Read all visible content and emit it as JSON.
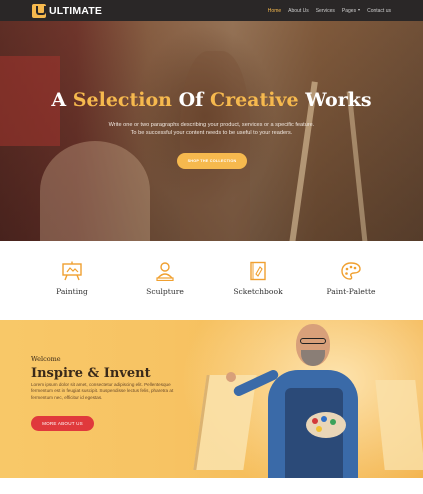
{
  "brand": {
    "name": "ULTIMATE",
    "logo_icon": "u-logo-icon",
    "accent": "#f6b94e"
  },
  "nav": {
    "items": [
      {
        "label": "Home",
        "active": true
      },
      {
        "label": "About Us"
      },
      {
        "label": "Services"
      },
      {
        "label": "Pages"
      },
      {
        "label": "Contact us"
      }
    ]
  },
  "hero": {
    "title_parts": [
      "A",
      "Selection",
      "Of",
      "Creative",
      "Works"
    ],
    "subtitle_line1": "Write one or two paragraphs describing your product, services or a specific feature.",
    "subtitle_line2": "To be successful your content needs to be useful to your readers.",
    "button_label": "SHOP THE COLLECTION"
  },
  "features": [
    {
      "label": "Painting",
      "icon": "easel-icon"
    },
    {
      "label": "Sculpture",
      "icon": "bust-icon"
    },
    {
      "label": "Scketchbook",
      "icon": "sketchbook-icon"
    },
    {
      "label": "Paint-Palette",
      "icon": "palette-icon"
    }
  ],
  "welcome": {
    "kicker": "Welcome",
    "title": "Inspire & Invent",
    "text": "Lorem ipsum dolor sit amet, consectetur adipiscing elit. Pellentesque fermentum est in feugiat suscipit. Suspendisse lectus felis, pharetra at fermentum nec, efficitur id egestas.",
    "button_label": "MORE ABOUT US",
    "button_color": "#e0393c",
    "background_color": "#f7c363"
  }
}
